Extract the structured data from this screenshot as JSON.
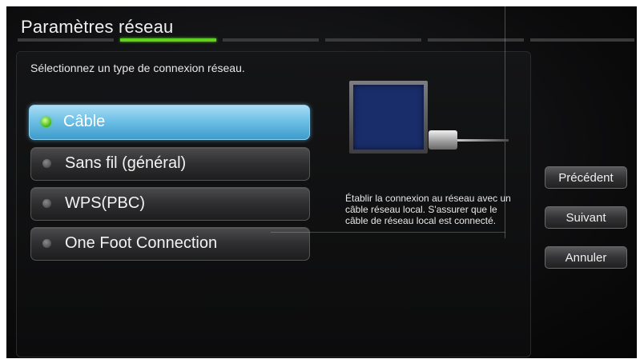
{
  "header": {
    "title": "Paramètres réseau",
    "progress": {
      "total_steps": 6,
      "current_step": 2
    }
  },
  "main": {
    "prompt": "Sélectionnez un type de connexion réseau.",
    "options": [
      {
        "label": "Câble",
        "selected": true
      },
      {
        "label": "Sans fil (général)",
        "selected": false
      },
      {
        "label": "WPS(PBC)",
        "selected": false
      },
      {
        "label": "One Foot Connection",
        "selected": false
      }
    ],
    "description": "Établir la connexion au réseau avec un câble réseau local. S'assurer que le câble de réseau local est connecté."
  },
  "buttons": {
    "previous": "Précédent",
    "next": "Suivant",
    "cancel": "Annuler"
  },
  "colors": {
    "accent_green": "#5ed21d",
    "selection_blue": "#6ec0e6"
  }
}
